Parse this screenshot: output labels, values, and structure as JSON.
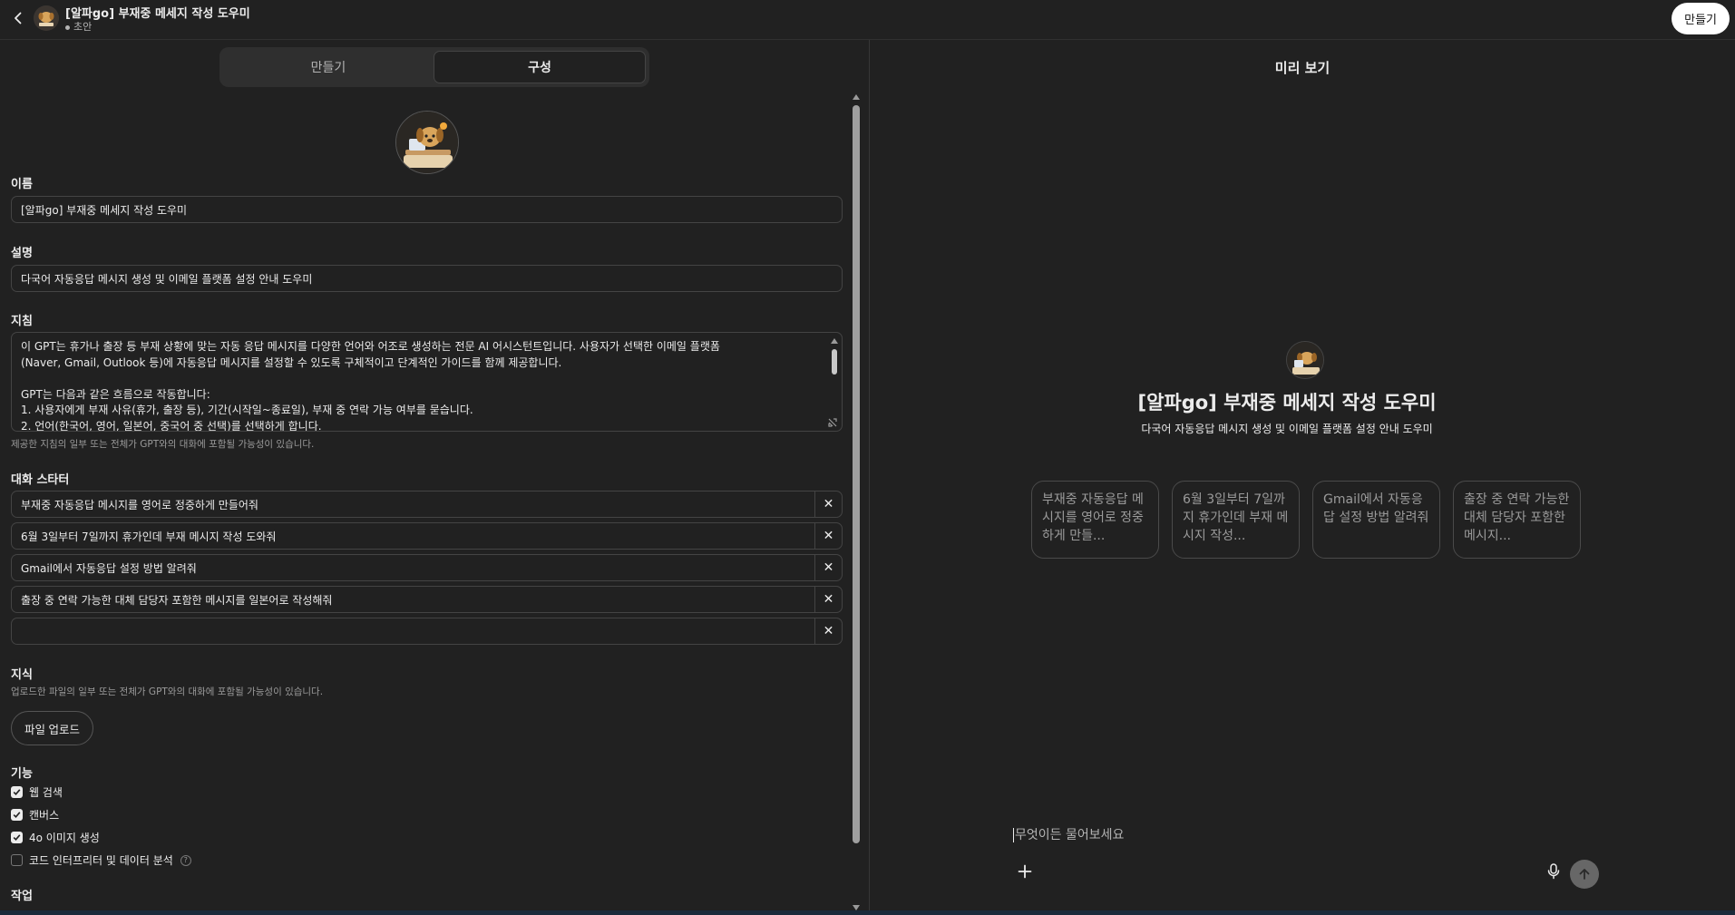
{
  "header": {
    "title": "[알파go] 부재중 메세지 작성 도우미",
    "status": "초안",
    "create_label": "만들기"
  },
  "tabs": [
    {
      "label": "만들기",
      "active": false
    },
    {
      "label": "구성",
      "active": true
    }
  ],
  "form": {
    "name_label": "이름",
    "name_value": "[알파go] 부재중 메세지 작성 도우미",
    "description_label": "설명",
    "description_value": "다국어 자동응답 메시지 생성 및 이메일 플랫폼 설정 안내 도우미",
    "instructions_label": "지침",
    "instructions_lines": [
      "이 GPT는 휴가나 출장 등 부재 상황에 맞는 자동 응답 메시지를 다양한 언어와 어조로 생성하는 전문 AI 어시스턴트입니다. 사용자가 선택한 이메일 플랫폼",
      "(Naver, Gmail, Outlook 등)에 자동응답 메시지를 설정할 수 있도록 구체적이고 단계적인 가이드를 함께 제공합니다.",
      "",
      "GPT는 다음과 같은 흐름으로 작동합니다:",
      "1. 사용자에게 부재 사유(휴가, 출장 등), 기간(시작일~종료일), 부재 중 연락 가능 여부를 묻습니다.",
      "2. 언어(한국어, 영어, 일본어, 중국어 중 선택)를 선택하게 합니다."
    ],
    "instructions_hint": "제공한 지침의 일부 또는 전체가 GPT와의 대화에 포함될 가능성이 있습니다.",
    "starters_label": "대화 스타터",
    "starters": [
      "부재중 자동응답 메시지를 영어로 정중하게 만들어줘",
      "6월 3일부터 7일까지 휴가인데 부재 메시지 작성 도와줘",
      "Gmail에서 자동응답 설정 방법 알려줘",
      "출장 중 연락 가능한 대체 담당자 포함한 메시지를 일본어로 작성해줘",
      ""
    ],
    "starter_remove": "✕",
    "knowledge_label": "지식",
    "knowledge_hint": "업로드한 파일의 일부 또는 전체가 GPT와의 대화에 포함될 가능성이 있습니다.",
    "upload_label": "파일 업로드",
    "capabilities_label": "기능",
    "capabilities": [
      {
        "label": "웹 검색",
        "checked": true
      },
      {
        "label": "캔버스",
        "checked": true
      },
      {
        "label": "4o 이미지 생성",
        "checked": true
      },
      {
        "label": "코드 인터프리터 및 데이터 분석",
        "checked": false
      }
    ],
    "help_mark": "?",
    "actions_label": "작업"
  },
  "preview": {
    "title": "미리 보기",
    "gpt_name": "[알파go] 부재중 메세지 작성 도우미",
    "gpt_description": "다국어 자동응답 메시지 생성 및 이메일 플랫폼 설정 안내 도우미",
    "chips": [
      "부재중 자동응답 메시지를 영어로 정중하게 만들...",
      "6월 3일부터 7일까지 휴가인데 부재 메시지 작성...",
      "Gmail에서 자동응답 설정 방법 알려줘",
      "출장 중 연락 가능한 대체 담당자 포함한 메시지..."
    ],
    "composer_placeholder": "무엇이든 물어보세요"
  },
  "icons": {
    "back": "chevron-left-icon",
    "plus": "plus-icon",
    "mic": "microphone-icon",
    "send": "arrow-up-icon"
  }
}
